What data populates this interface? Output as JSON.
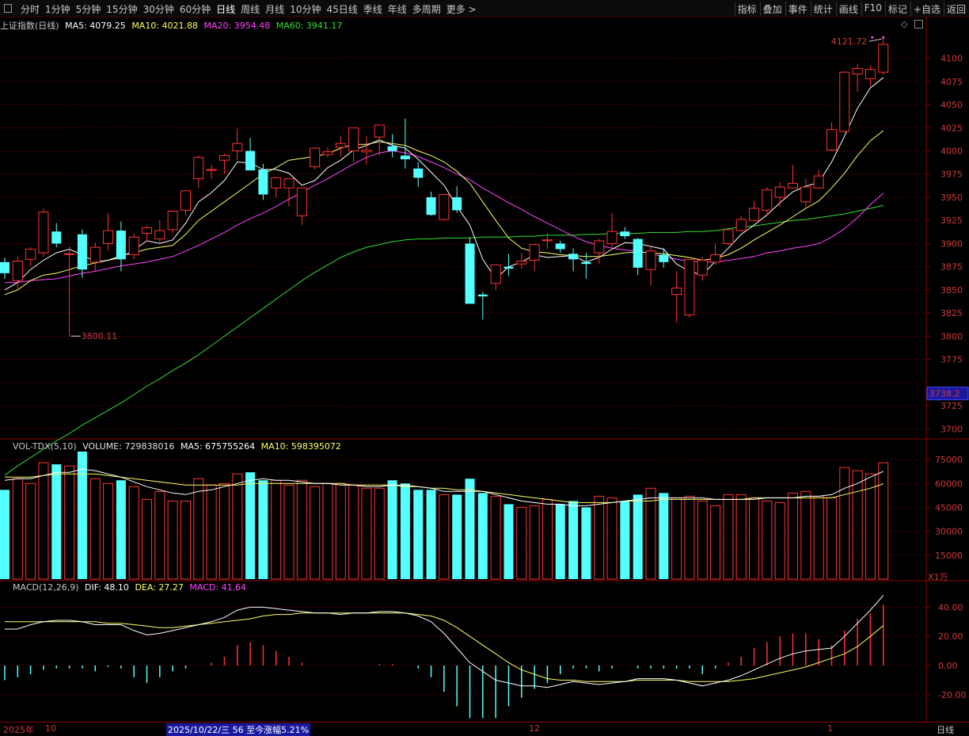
{
  "toolbar": {
    "left_items": [
      "分时",
      "1分钟",
      "5分钟",
      "15分钟",
      "30分钟",
      "60分钟",
      "日线",
      "周线",
      "月线",
      "10分钟",
      "45日线",
      "季线",
      "年线",
      "多周期",
      "更多 >"
    ],
    "active": "日线",
    "right_items": [
      "指标",
      "叠加",
      "事件",
      "统计",
      "画线",
      "F10",
      "标记",
      "+自选",
      "返回"
    ]
  },
  "main_panel": {
    "title": "上证指数(日线)",
    "ma5_label": "MA5: 4079.25",
    "ma10_label": "MA10: 4021.88",
    "ma20_label": "MA20: 3954.48",
    "ma60_label": "MA60: 3941.17",
    "high_marker": "4121.72",
    "low_marker": "3800.11",
    "price_ticks": [
      "4100",
      "4075",
      "4050",
      "4025",
      "4000",
      "3975",
      "3950",
      "3925",
      "3900",
      "3875",
      "3850",
      "3825",
      "3800",
      "3775",
      "3725",
      "3700"
    ],
    "current_price_tag": "3738.2"
  },
  "volume_panel": {
    "title": "VOL-TDX(5,10)",
    "volume_label": "VOLUME: 729838016",
    "ma5_label": "MA5: 675755264",
    "ma10_label": "MA10: 598395072",
    "ticks": [
      "75000",
      "60000",
      "45000",
      "30000",
      "15000"
    ],
    "unit": "X1万"
  },
  "macd_panel": {
    "title": "MACD(12,26,9)",
    "dif_label": "DIF: 48.10",
    "dea_label": "DEA: 27.27",
    "macd_label": "MACD: 41.64",
    "ticks": [
      "40.00",
      "20.00",
      "0.00",
      "-20.00"
    ]
  },
  "bottom_bar": {
    "year": "2025年",
    "month_labels": [
      "10",
      "12",
      "1"
    ],
    "date_info": "2025/10/22/三 56 至今涨幅5.21%",
    "period": "日线"
  },
  "colors": {
    "up": "#ff3232",
    "down": "#54ffff",
    "ma5": "#ffffff",
    "ma10": "#ffff66",
    "ma20": "#ff44ff",
    "ma60": "#33dd33",
    "grid": "#8b0000"
  },
  "chart_data": {
    "type": "candlestick",
    "ohlc": [
      [
        3880,
        3885,
        3862,
        3868
      ],
      [
        3860,
        3886,
        3852,
        3881
      ],
      [
        3883,
        3896,
        3876,
        3894
      ],
      [
        3890,
        3938,
        3886,
        3934
      ],
      [
        3913,
        3922,
        3896,
        3900
      ],
      [
        3889,
        3897,
        3800,
        3889
      ],
      [
        3910,
        3915,
        3863,
        3872
      ],
      [
        3880,
        3901,
        3870,
        3896
      ],
      [
        3900,
        3933,
        3893,
        3914
      ],
      [
        3914,
        3924,
        3870,
        3883
      ],
      [
        3888,
        3911,
        3883,
        3907
      ],
      [
        3911,
        3919,
        3902,
        3917
      ],
      [
        3905,
        3925,
        3900,
        3914
      ],
      [
        3915,
        3930,
        3911,
        3935
      ],
      [
        3936,
        3955,
        3930,
        3957
      ],
      [
        3970,
        3995,
        3960,
        3993
      ],
      [
        3979,
        3985,
        3970,
        3980
      ],
      [
        3990,
        3997,
        3975,
        3995
      ],
      [
        4000,
        4024,
        3990,
        4008
      ],
      [
        4000,
        4014,
        3982,
        3979
      ],
      [
        3980,
        3986,
        3947,
        3953
      ],
      [
        3960,
        3972,
        3950,
        3971
      ],
      [
        3960,
        3970,
        3940,
        3970
      ],
      [
        3930,
        3930,
        3920,
        3960
      ],
      [
        3983,
        4002,
        3980,
        4003
      ],
      [
        3996,
        4004,
        3993,
        3999
      ],
      [
        4004,
        4016,
        3994,
        4008
      ],
      [
        4000,
        4025,
        3988,
        4025
      ],
      [
        3999,
        4016,
        3985,
        4001
      ],
      [
        4015,
        4025,
        3995,
        4028
      ],
      [
        4005,
        4018,
        3993,
        4000
      ],
      [
        3995,
        4035,
        3981,
        3991
      ],
      [
        3981,
        3988,
        3961,
        3971
      ],
      [
        3950,
        3956,
        3930,
        3931
      ],
      [
        3926,
        3950,
        3925,
        3953
      ],
      [
        3950,
        3962,
        3933,
        3936
      ],
      [
        3900,
        3907,
        3840,
        3835
      ],
      [
        3845,
        3848,
        3818,
        3843
      ],
      [
        3857,
        3870,
        3850,
        3877
      ],
      [
        3875,
        3889,
        3865,
        3873
      ],
      [
        3878,
        3890,
        3873,
        3881
      ],
      [
        3882,
        3895,
        3870,
        3899
      ],
      [
        3903,
        3911,
        3894,
        3904
      ],
      [
        3900,
        3903,
        3890,
        3894
      ],
      [
        3889,
        3895,
        3870,
        3883
      ],
      [
        3880,
        3890,
        3862,
        3878
      ],
      [
        3890,
        3905,
        3878,
        3903
      ],
      [
        3900,
        3933,
        3893,
        3913
      ],
      [
        3913,
        3918,
        3905,
        3908
      ],
      [
        3905,
        3906,
        3866,
        3874
      ],
      [
        3872,
        3897,
        3855,
        3892
      ],
      [
        3888,
        3895,
        3874,
        3880
      ],
      [
        3845,
        3870,
        3815,
        3852
      ],
      [
        3823,
        3877,
        3820,
        3883
      ],
      [
        3866,
        3885,
        3860,
        3882
      ],
      [
        3880,
        3900,
        3877,
        3888
      ],
      [
        3900,
        3913,
        3898,
        3915
      ],
      [
        3914,
        3930,
        3913,
        3926
      ],
      [
        3925,
        3946,
        3924,
        3938
      ],
      [
        3936,
        3961,
        3930,
        3958
      ],
      [
        3950,
        3966,
        3940,
        3961
      ],
      [
        3960,
        3985,
        3960,
        3965
      ],
      [
        3945,
        3970,
        3939,
        3961
      ],
      [
        3960,
        3980,
        3960,
        3973
      ],
      [
        4001,
        4031,
        4000,
        4023
      ],
      [
        4021,
        4086,
        4020,
        4085
      ],
      [
        4083,
        4094,
        4064,
        4089
      ],
      [
        4078,
        4092,
        4070,
        4088
      ],
      [
        4085,
        4121.72,
        4082,
        4115
      ]
    ],
    "ma5": [
      3850,
      3858,
      3872,
      3882,
      3890,
      3894,
      3888,
      3880,
      3882,
      3885,
      3893,
      3903,
      3900,
      3904,
      3922,
      3945,
      3955,
      3968,
      3988,
      3987,
      3980,
      3980,
      3976,
      3963,
      3968,
      3982,
      3990,
      4001,
      4006,
      4012,
      4006,
      4003,
      3991,
      3977,
      3963,
      3940,
      3920,
      3883,
      3862,
      3875,
      3880,
      3888,
      3885,
      3886,
      3887,
      3880,
      3885,
      3894,
      3901,
      3900,
      3897,
      3894,
      3878,
      3870,
      3866,
      3881,
      3895,
      3910,
      3920,
      3931,
      3944,
      3956,
      3962,
      3966,
      3988,
      4016,
      4046,
      4068,
      4079.25
    ],
    "ma10": [
      3845,
      3850,
      3860,
      3866,
      3868,
      3872,
      3876,
      3879,
      3882,
      3887,
      3890,
      3894,
      3896,
      3898,
      3910,
      3925,
      3935,
      3945,
      3955,
      3965,
      3975,
      3982,
      3990,
      3992,
      3994,
      3997,
      4003,
      4007,
      4007,
      4010,
      4008,
      4006,
      4000,
      3995,
      3988,
      3978,
      3965,
      3945,
      3925,
      3906,
      3895,
      3891,
      3890,
      3888,
      3887,
      3886,
      3886,
      3888,
      3890,
      3891,
      3890,
      3889,
      3887,
      3885,
      3882,
      3884,
      3888,
      3895,
      3904,
      3912,
      3920,
      3929,
      3938,
      3946,
      3960,
      3976,
      3995,
      4011,
      4021.88
    ],
    "ma20": [
      3858,
      3858,
      3860,
      3861,
      3862,
      3865,
      3868,
      3870,
      3873,
      3876,
      3878,
      3880,
      3883,
      3886,
      3892,
      3898,
      3905,
      3912,
      3920,
      3927,
      3933,
      3940,
      3948,
      3955,
      3963,
      3970,
      3978,
      3986,
      3993,
      3998,
      4000,
      3998,
      3994,
      3988,
      3982,
      3975,
      3969,
      3960,
      3952,
      3944,
      3937,
      3929,
      3922,
      3915,
      3908,
      3902,
      3898,
      3895,
      3893,
      3892,
      3889,
      3886,
      3883,
      3881,
      3880,
      3880,
      3882,
      3884,
      3886,
      3890,
      3892,
      3895,
      3897,
      3900,
      3907,
      3916,
      3928,
      3942,
      3954.48
    ],
    "ma60": [
      3650,
      3660,
      3669,
      3678,
      3687,
      3695,
      3704,
      3712,
      3720,
      3728,
      3737,
      3746,
      3754,
      3763,
      3771,
      3780,
      3790,
      3800,
      3810,
      3820,
      3830,
      3840,
      3850,
      3860,
      3869,
      3877,
      3885,
      3891,
      3896,
      3899,
      3902,
      3904,
      3905,
      3905,
      3906,
      3906,
      3906,
      3907,
      3907,
      3907,
      3908,
      3908,
      3909,
      3909,
      3909,
      3910,
      3910,
      3911,
      3911,
      3911,
      3912,
      3912,
      3912,
      3913,
      3913,
      3914,
      3916,
      3918,
      3919,
      3921,
      3923,
      3925,
      3926,
      3928,
      3930,
      3932,
      3935,
      3938,
      3941.17
    ],
    "volume": [
      56000,
      63000,
      60000,
      73000,
      72000,
      71000,
      80000,
      63000,
      60000,
      62000,
      58000,
      50000,
      55000,
      49000,
      49000,
      63000,
      59000,
      60000,
      66000,
      67000,
      62000,
      62000,
      59000,
      62000,
      58000,
      60000,
      60000,
      59000,
      57000,
      57000,
      62000,
      60000,
      56000,
      56000,
      53000,
      53000,
      63000,
      54000,
      52000,
      47000,
      45000,
      46000,
      50000,
      47000,
      49000,
      45000,
      52000,
      51000,
      49000,
      53000,
      57000,
      54000,
      51000,
      52000,
      49000,
      46000,
      53000,
      53000,
      51000,
      49000,
      48000,
      54000,
      55000,
      52000,
      51000,
      70000,
      68000,
      66000,
      72983
    ],
    "vol_ma5": [
      62000,
      63000,
      63000,
      65000,
      67000,
      67000,
      69000,
      68000,
      66000,
      64000,
      61000,
      58000,
      56000,
      54000,
      53000,
      55000,
      56000,
      58000,
      60000,
      62000,
      63000,
      62000,
      62000,
      61000,
      60000,
      60000,
      59000,
      59000,
      58000,
      58000,
      59000,
      59000,
      58000,
      57000,
      55000,
      55000,
      55000,
      55000,
      53000,
      51000,
      49000,
      48000,
      47000,
      47000,
      46000,
      46000,
      47000,
      48000,
      49000,
      50000,
      51000,
      51000,
      51000,
      51000,
      51000,
      50000,
      50000,
      50000,
      50000,
      51000,
      51000,
      51000,
      52000,
      52000,
      53000,
      57000,
      60000,
      64000,
      67576
    ],
    "vol_ma10": [
      64000,
      64000,
      64000,
      65000,
      66000,
      66000,
      66000,
      66000,
      65000,
      64000,
      63000,
      62000,
      61000,
      60000,
      59000,
      59000,
      59000,
      59000,
      59000,
      60000,
      60000,
      60000,
      60000,
      60000,
      60000,
      60000,
      60000,
      59000,
      59000,
      59000,
      59000,
      58000,
      58000,
      57000,
      57000,
      56000,
      56000,
      55000,
      54000,
      53000,
      52000,
      51000,
      50000,
      49000,
      48000,
      48000,
      48000,
      48000,
      49000,
      49000,
      49000,
      50000,
      50000,
      50000,
      50000,
      50000,
      50000,
      50000,
      51000,
      51000,
      51000,
      51000,
      51000,
      51000,
      51000,
      53000,
      55000,
      57000,
      59840
    ],
    "dif": [
      25,
      25,
      28,
      30,
      31,
      31,
      30,
      28,
      28,
      28,
      24,
      21,
      22,
      24,
      26,
      28,
      30,
      33,
      38,
      40,
      40,
      39,
      38,
      37,
      36,
      36,
      35,
      36,
      36,
      37,
      37,
      36,
      34,
      30,
      22,
      12,
      2,
      -4,
      -10,
      -12,
      -14,
      -14,
      -15,
      -13,
      -11,
      -12,
      -13,
      -12,
      -11,
      -9,
      -9,
      -9,
      -10,
      -12,
      -14,
      -12,
      -10,
      -7,
      -3,
      1,
      5,
      8,
      10,
      11,
      12,
      20,
      29,
      38,
      48.1
    ],
    "dea": [
      30,
      30,
      30,
      30,
      30,
      30,
      30,
      30,
      29,
      29,
      28,
      27,
      26,
      26,
      27,
      28,
      29,
      30,
      31,
      32,
      34,
      35,
      35,
      36,
      36,
      36,
      36,
      36,
      36,
      36,
      36,
      36,
      35,
      34,
      31,
      26,
      20,
      14,
      8,
      2,
      -3,
      -6,
      -9,
      -10,
      -10,
      -11,
      -11,
      -11,
      -11,
      -10,
      -10,
      -10,
      -10,
      -11,
      -11,
      -11,
      -11,
      -10,
      -9,
      -7,
      -5,
      -3,
      -1,
      2,
      5,
      8,
      13,
      20,
      27.27
    ],
    "macd": [
      -10,
      -8,
      -6,
      -3,
      -2,
      -2,
      -2,
      -4,
      -1,
      -2,
      -8,
      -12,
      -8,
      -4,
      -2,
      0,
      2,
      6,
      14,
      16,
      14,
      10,
      6,
      2,
      0,
      0,
      0,
      0,
      0,
      1,
      1,
      0,
      -2,
      -8,
      -18,
      -28,
      -36,
      -36,
      -36,
      -28,
      -22,
      -16,
      -12,
      -6,
      -2,
      -2,
      -4,
      -2,
      0,
      -2,
      -2,
      -2,
      -2,
      -2,
      -6,
      -2,
      2,
      6,
      12,
      16,
      20,
      22,
      22,
      18,
      14,
      24,
      32,
      36,
      41.64
    ]
  }
}
